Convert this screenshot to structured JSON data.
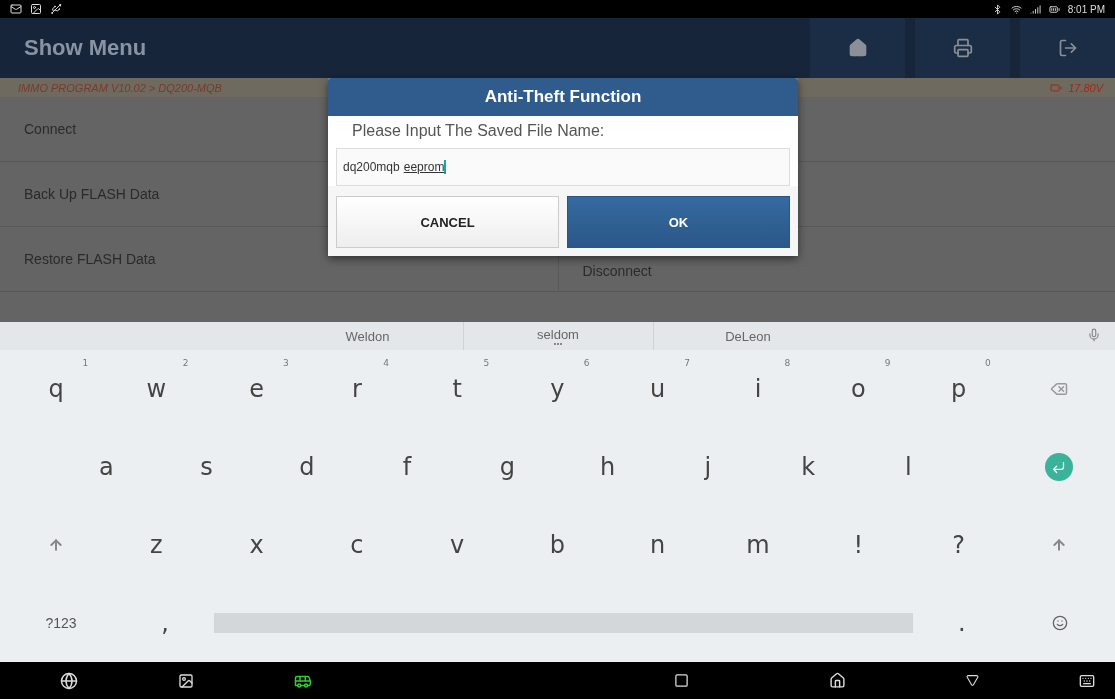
{
  "status_bar": {
    "time": "8:01 PM"
  },
  "header": {
    "title": "Show Menu"
  },
  "breadcrumb": {
    "path": "IMMO PROGRAM V10.02 > DQ200-MQB",
    "voltage": "17.80V"
  },
  "menu": {
    "rows": [
      {
        "left": "Connect"
      },
      {
        "left": "Back Up FLASH Data"
      },
      {
        "left": "Restore FLASH Data",
        "right": "Disconnect"
      }
    ]
  },
  "dialog": {
    "title": "Anti-Theft Function",
    "prompt": "Please Input The Saved File Name:",
    "value": "dq200mqb",
    "composing": "eeprom",
    "buttons": [
      {
        "label": "CANCEL",
        "kind": "secondary"
      },
      {
        "label": "OK",
        "kind": "primary"
      }
    ]
  },
  "keyboard": {
    "suggestions": [
      {
        "text": "Weldon",
        "has_more": false
      },
      {
        "text": "seldom",
        "has_more": true
      },
      {
        "text": "DeLeon",
        "has_more": false
      }
    ],
    "rows": [
      {
        "keys": [
          {
            "kind": "char",
            "label": "q",
            "hint": "1"
          },
          {
            "kind": "char",
            "label": "w",
            "hint": "2"
          },
          {
            "kind": "char",
            "label": "e",
            "hint": "3"
          },
          {
            "kind": "char",
            "label": "r",
            "hint": "4"
          },
          {
            "kind": "char",
            "label": "t",
            "hint": "5"
          },
          {
            "kind": "char",
            "label": "y",
            "hint": "6"
          },
          {
            "kind": "char",
            "label": "u",
            "hint": "7"
          },
          {
            "kind": "char",
            "label": "i",
            "hint": "8"
          },
          {
            "kind": "char",
            "label": "o",
            "hint": "9"
          },
          {
            "kind": "char",
            "label": "p",
            "hint": "0"
          },
          {
            "kind": "backspace"
          }
        ]
      },
      {
        "keys": [
          {
            "kind": "half"
          },
          {
            "kind": "char",
            "label": "a"
          },
          {
            "kind": "char",
            "label": "s"
          },
          {
            "kind": "char",
            "label": "d"
          },
          {
            "kind": "char",
            "label": "f"
          },
          {
            "kind": "char",
            "label": "g"
          },
          {
            "kind": "char",
            "label": "h"
          },
          {
            "kind": "char",
            "label": "j"
          },
          {
            "kind": "char",
            "label": "k"
          },
          {
            "kind": "char",
            "label": "l"
          },
          {
            "kind": "half"
          },
          {
            "kind": "enter"
          }
        ]
      },
      {
        "keys": [
          {
            "kind": "shift"
          },
          {
            "kind": "char",
            "label": "z"
          },
          {
            "kind": "char",
            "label": "x"
          },
          {
            "kind": "char",
            "label": "c"
          },
          {
            "kind": "char",
            "label": "v"
          },
          {
            "kind": "char",
            "label": "b"
          },
          {
            "kind": "char",
            "label": "n"
          },
          {
            "kind": "char",
            "label": "m"
          },
          {
            "kind": "char",
            "label": "!"
          },
          {
            "kind": "char",
            "label": "?"
          },
          {
            "kind": "shift"
          }
        ]
      },
      {
        "keys": [
          {
            "kind": "small",
            "label": "?123"
          },
          {
            "kind": "char",
            "label": ","
          },
          {
            "kind": "space"
          },
          {
            "kind": "char",
            "label": "."
          },
          {
            "kind": "emoji"
          }
        ]
      }
    ]
  }
}
